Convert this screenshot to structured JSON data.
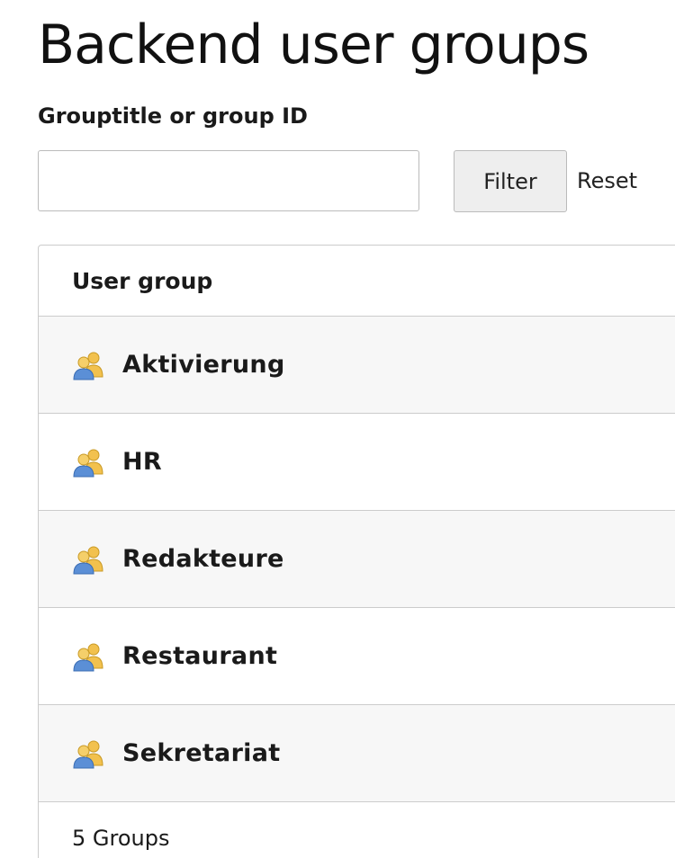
{
  "page": {
    "title": "Backend user groups"
  },
  "filter": {
    "label": "Grouptitle or group ID",
    "value": "",
    "placeholder": "",
    "button_label": "Filter",
    "reset_label": "Reset"
  },
  "table": {
    "header": "User group",
    "rows": [
      {
        "label": "Aktivierung",
        "icon": "user-group-icon"
      },
      {
        "label": "HR",
        "icon": "user-group-icon"
      },
      {
        "label": "Redakteure",
        "icon": "user-group-icon"
      },
      {
        "label": "Restaurant",
        "icon": "user-group-icon"
      },
      {
        "label": "Sekretariat",
        "icon": "user-group-icon"
      }
    ],
    "footer": "5 Groups"
  },
  "colors": {
    "row_alt": "#f7f7f7",
    "border": "#cccccc",
    "button_bg": "#eeeeee",
    "icon_blue": "#5b8fd6",
    "icon_yellow": "#f2c14e"
  }
}
